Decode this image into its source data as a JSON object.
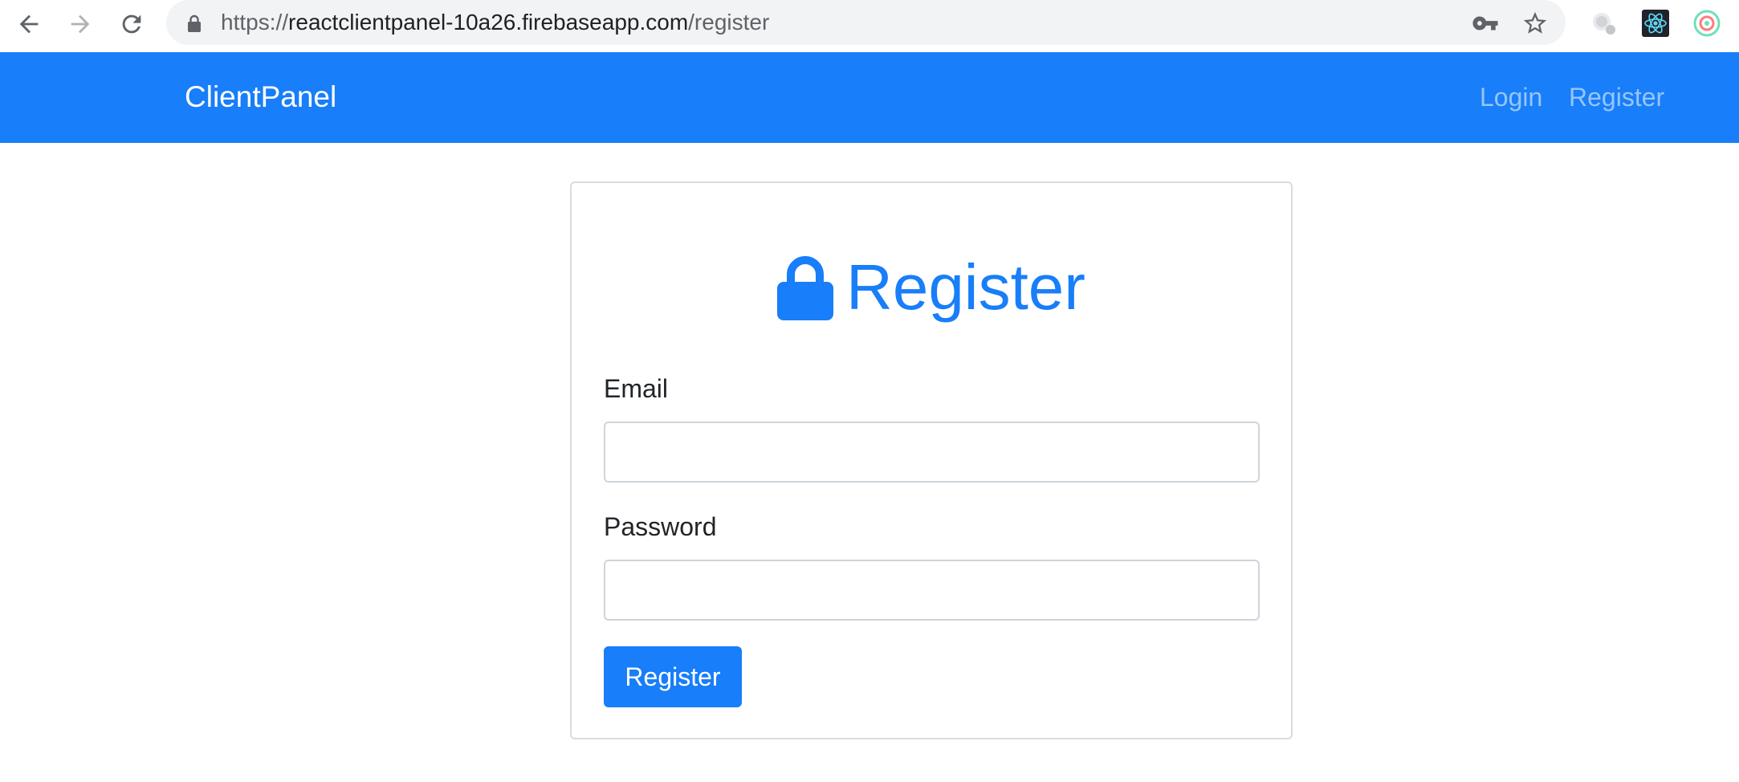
{
  "browser": {
    "url_scheme": "https://",
    "url_host": "reactclientpanel-10a26.firebaseapp.com",
    "url_path": "/register",
    "icons": [
      "back-icon",
      "forward-icon",
      "reload-icon",
      "lock-icon",
      "key-icon",
      "star-icon",
      "extension-icon",
      "react-devtools-icon",
      "extension-ring-icon"
    ]
  },
  "navbar": {
    "brand": "ClientPanel",
    "links": [
      {
        "label": "Login"
      },
      {
        "label": "Register"
      }
    ],
    "background": "#187ef9"
  },
  "card": {
    "title": "Register",
    "title_icon": "lock-icon",
    "email_label": "Email",
    "email_value": "",
    "password_label": "Password",
    "password_value": "",
    "submit_label": "Register"
  },
  "colors": {
    "primary": "#187ef9",
    "text": "#212529",
    "border": "#ced4da"
  }
}
